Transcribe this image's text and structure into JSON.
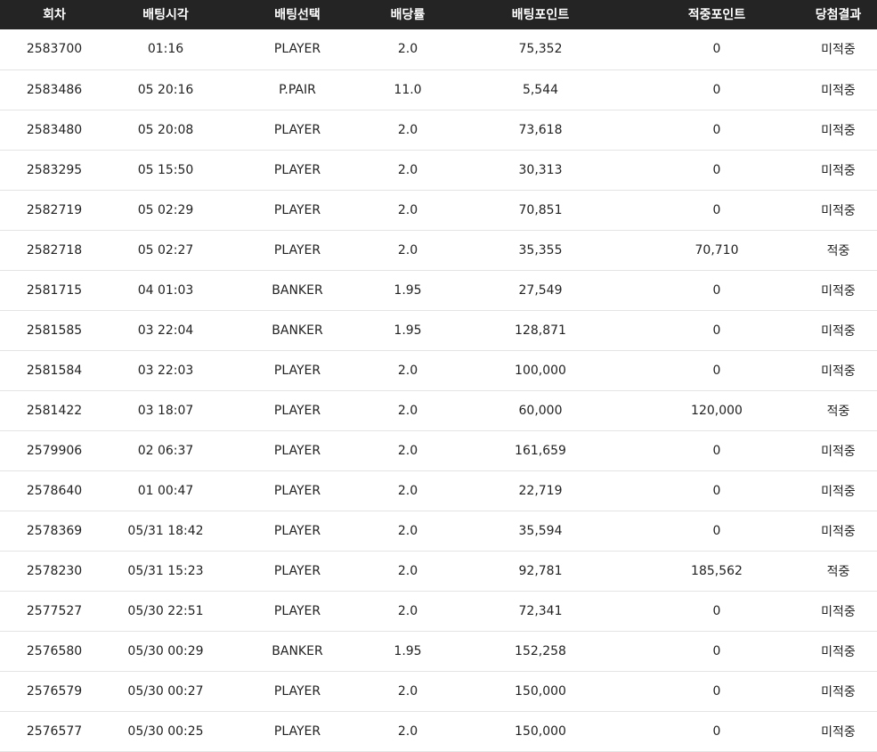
{
  "table": {
    "headers": {
      "round": "회차",
      "time": "배팅시각",
      "choice": "배팅선택",
      "odds": "배당률",
      "bet_points": "배팅포인트",
      "win_points": "적중포인트",
      "result": "당첨결과"
    },
    "rows": [
      {
        "round": "2583700",
        "time": "01:16",
        "choice": "PLAYER",
        "odds": "2.0",
        "bet_points": "75,352",
        "win_points": "0",
        "result": "미적중"
      },
      {
        "round": "2583486",
        "time": "05 20:16",
        "choice": "P.PAIR",
        "odds": "11.0",
        "bet_points": "5,544",
        "win_points": "0",
        "result": "미적중"
      },
      {
        "round": "2583480",
        "time": "05 20:08",
        "choice": "PLAYER",
        "odds": "2.0",
        "bet_points": "73,618",
        "win_points": "0",
        "result": "미적중"
      },
      {
        "round": "2583295",
        "time": "05 15:50",
        "choice": "PLAYER",
        "odds": "2.0",
        "bet_points": "30,313",
        "win_points": "0",
        "result": "미적중"
      },
      {
        "round": "2582719",
        "time": "05 02:29",
        "choice": "PLAYER",
        "odds": "2.0",
        "bet_points": "70,851",
        "win_points": "0",
        "result": "미적중"
      },
      {
        "round": "2582718",
        "time": "05 02:27",
        "choice": "PLAYER",
        "odds": "2.0",
        "bet_points": "35,355",
        "win_points": "70,710",
        "result": "적중"
      },
      {
        "round": "2581715",
        "time": "04 01:03",
        "choice": "BANKER",
        "odds": "1.95",
        "bet_points": "27,549",
        "win_points": "0",
        "result": "미적중"
      },
      {
        "round": "2581585",
        "time": "03 22:04",
        "choice": "BANKER",
        "odds": "1.95",
        "bet_points": "128,871",
        "win_points": "0",
        "result": "미적중"
      },
      {
        "round": "2581584",
        "time": "03 22:03",
        "choice": "PLAYER",
        "odds": "2.0",
        "bet_points": "100,000",
        "win_points": "0",
        "result": "미적중"
      },
      {
        "round": "2581422",
        "time": "03 18:07",
        "choice": "PLAYER",
        "odds": "2.0",
        "bet_points": "60,000",
        "win_points": "120,000",
        "result": "적중"
      },
      {
        "round": "2579906",
        "time": "02 06:37",
        "choice": "PLAYER",
        "odds": "2.0",
        "bet_points": "161,659",
        "win_points": "0",
        "result": "미적중"
      },
      {
        "round": "2578640",
        "time": "01 00:47",
        "choice": "PLAYER",
        "odds": "2.0",
        "bet_points": "22,719",
        "win_points": "0",
        "result": "미적중"
      },
      {
        "round": "2578369",
        "time": "05/31 18:42",
        "choice": "PLAYER",
        "odds": "2.0",
        "bet_points": "35,594",
        "win_points": "0",
        "result": "미적중"
      },
      {
        "round": "2578230",
        "time": "05/31 15:23",
        "choice": "PLAYER",
        "odds": "2.0",
        "bet_points": "92,781",
        "win_points": "185,562",
        "result": "적중"
      },
      {
        "round": "2577527",
        "time": "05/30 22:51",
        "choice": "PLAYER",
        "odds": "2.0",
        "bet_points": "72,341",
        "win_points": "0",
        "result": "미적중"
      },
      {
        "round": "2576580",
        "time": "05/30 00:29",
        "choice": "BANKER",
        "odds": "1.95",
        "bet_points": "152,258",
        "win_points": "0",
        "result": "미적중"
      },
      {
        "round": "2576579",
        "time": "05/30 00:27",
        "choice": "PLAYER",
        "odds": "2.0",
        "bet_points": "150,000",
        "win_points": "0",
        "result": "미적중"
      },
      {
        "round": "2576577",
        "time": "05/30 00:25",
        "choice": "PLAYER",
        "odds": "2.0",
        "bet_points": "150,000",
        "win_points": "0",
        "result": "미적중"
      }
    ]
  }
}
